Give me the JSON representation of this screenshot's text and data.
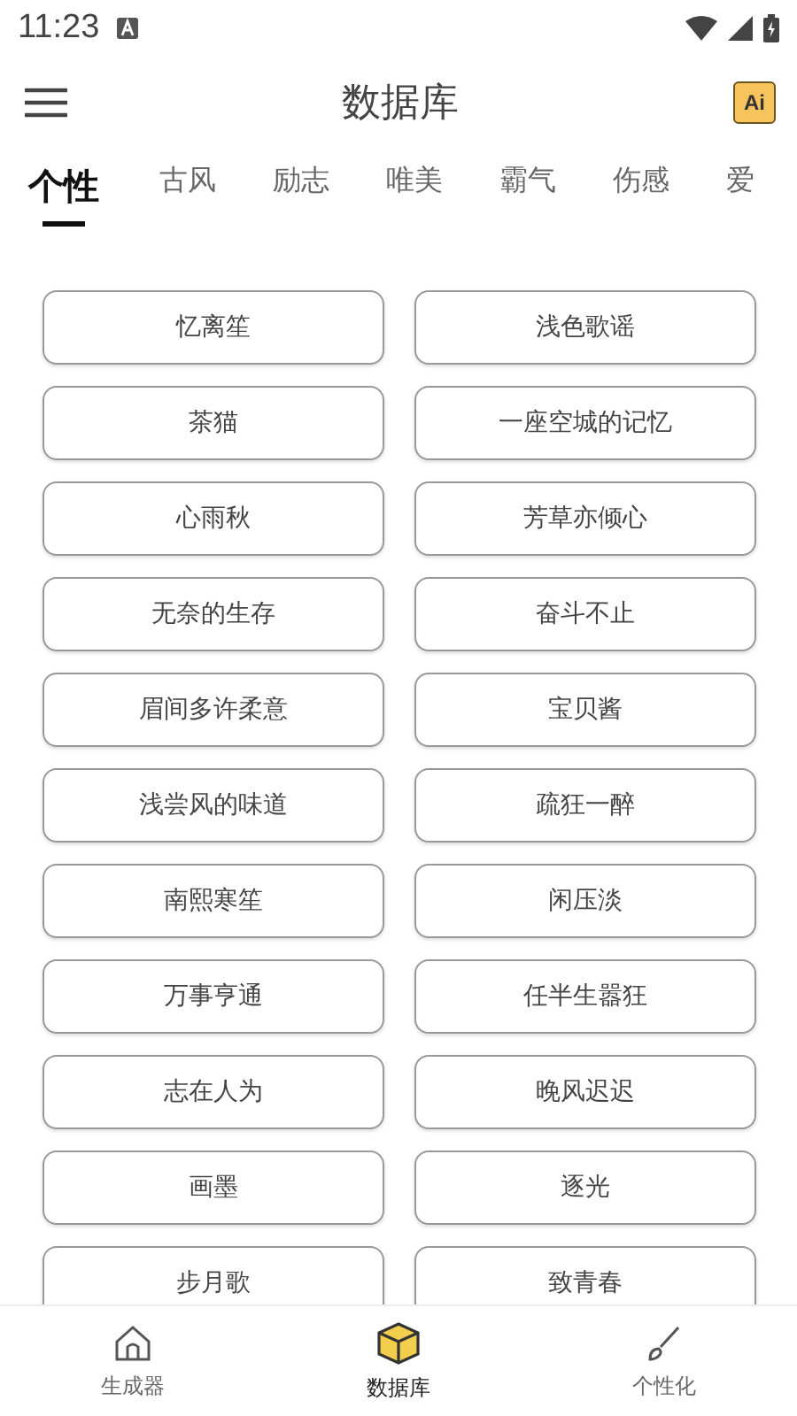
{
  "status_bar": {
    "time": "11:23"
  },
  "toolbar": {
    "title": "数据库",
    "badge": "Ai"
  },
  "tabs": [
    {
      "label": "个性",
      "selected": true
    },
    {
      "label": "古风",
      "selected": false
    },
    {
      "label": "励志",
      "selected": false
    },
    {
      "label": "唯美",
      "selected": false
    },
    {
      "label": "霸气",
      "selected": false
    },
    {
      "label": "伤感",
      "selected": false
    },
    {
      "label": "爱",
      "selected": false
    }
  ],
  "names": [
    "忆离笙",
    "浅色歌谣",
    "茶猫",
    "一座空城的记忆",
    "心雨秋",
    "芳草亦倾心",
    "无奈的生存",
    "奋斗不止",
    "眉间多许柔意",
    "宝贝酱",
    "浅尝风的味道",
    "疏狂一醉",
    "南熙寒笙",
    "闲压淡",
    "万事亨通",
    "任半生嚣狂",
    "志在人为",
    "晚风迟迟",
    "画墨",
    "逐光",
    "步月歌",
    "致青春"
  ],
  "bottom_nav": [
    {
      "label": "生成器",
      "kind": "home",
      "selected": false
    },
    {
      "label": "数据库",
      "kind": "cube",
      "selected": true
    },
    {
      "label": "个性化",
      "kind": "brush",
      "selected": false
    }
  ]
}
